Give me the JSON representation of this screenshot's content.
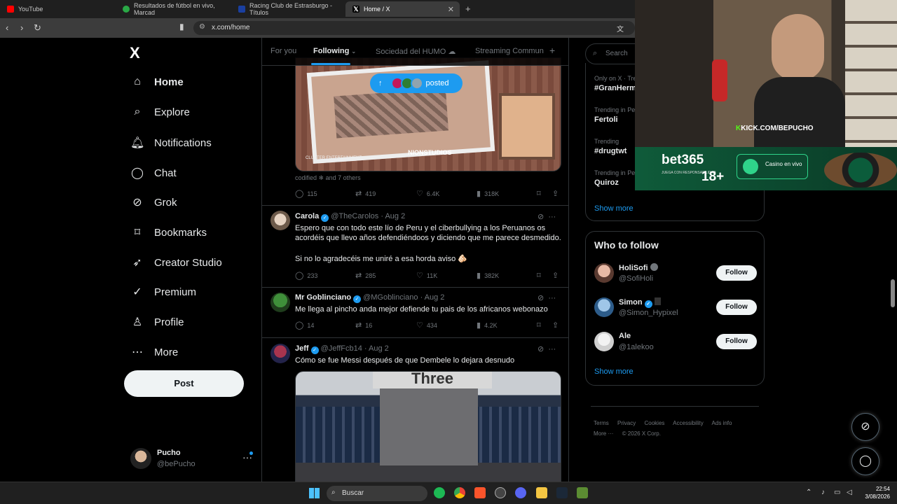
{
  "browser": {
    "tabs": [
      {
        "title": "YouTube",
        "color": "#ff0000"
      },
      {
        "title": "Resultados de fútbol en vivo, Marcad",
        "color": "#2aa846"
      },
      {
        "title": "Racing Club de Estrasburgo - Títulos",
        "color": "#1a3fa0"
      },
      {
        "title": "Home / X",
        "color": "#000000"
      }
    ],
    "url": "x.com/home"
  },
  "sidebar": {
    "logo": "X",
    "items": [
      {
        "label": "Home",
        "icon": "⌂"
      },
      {
        "label": "Explore",
        "icon": "⌕"
      },
      {
        "label": "Notifications",
        "icon": "♫"
      },
      {
        "label": "Chat",
        "icon": "◯"
      },
      {
        "label": "Grok",
        "icon": "⊘"
      },
      {
        "label": "Bookmarks",
        "icon": "⌑"
      },
      {
        "label": "Creator Studio",
        "icon": "➶"
      },
      {
        "label": "Premium",
        "icon": "✓"
      },
      {
        "label": "Profile",
        "icon": "♙"
      },
      {
        "label": "More",
        "icon": "⋯"
      }
    ],
    "post_label": "Post",
    "account": {
      "name": "Pucho",
      "handle": "@bePucho"
    }
  },
  "feed": {
    "tabs": [
      "For you",
      "Following",
      "Sociedad del HUMO ☁",
      "Streaming Commun"
    ],
    "posted_pill": "posted",
    "first_post": {
      "media_caption": "CLUSTER ENTERTAINMENT",
      "media_brand": "NIONSTUDIOS",
      "likers": "codified ❄ and 7 others",
      "replies": "115",
      "reposts": "419",
      "likes": "6.4K",
      "views": "318K"
    },
    "tweets": [
      {
        "name": "Carola",
        "handle": "@TheCarolos",
        "date": "· Aug 2",
        "text": "Espero que con todo este lío de Peru y el ciberbullying a los Peruanos os acordéis que llevo años defendiéndoos y diciendo que me parece desmedido.",
        "text2": "Si no lo agradecéis me uniré a esa horda aviso 🫵🏻",
        "replies": "233",
        "reposts": "285",
        "likes": "11K",
        "views": "382K"
      },
      {
        "name": "Mr Goblinciano",
        "handle": "@MGoblinciano",
        "date": "· Aug 2",
        "text": "Me llega al pincho anda mejor defiende tu pais de los africanos webonazo",
        "replies": "14",
        "reposts": "16",
        "likes": "434",
        "views": "4.2K"
      },
      {
        "name": "Jeff",
        "handle": "@JeffFcb14",
        "date": "· Aug 2",
        "text": "Cómo se fue Messi después de que Dembele lo dejara desnudo",
        "media_text": "Three"
      }
    ]
  },
  "right": {
    "search_placeholder": "Search",
    "trends": [
      {
        "context": "Only on X · Tre",
        "topic": "#GranHerm"
      },
      {
        "context": "Trending in Pe",
        "topic": "Fertoli"
      },
      {
        "context": "Trending",
        "topic": "#drugtwt"
      },
      {
        "context": "Trending in Pe",
        "topic": "Quiroz"
      }
    ],
    "show_more": "Show more",
    "who_to_follow_title": "Who to follow",
    "follow_suggestions": [
      {
        "name": "HoliSofi",
        "handle": "@SofiHoli"
      },
      {
        "name": "Simon",
        "handle": "@Simon_Hypixel"
      },
      {
        "name": "Ale",
        "handle": "@1alekoo"
      }
    ],
    "follow_label": "Follow",
    "footer_links": [
      "Terms",
      "Privacy",
      "Cookies",
      "Accessibility",
      "Ads info",
      "More ···",
      "© 2026 X Corp."
    ]
  },
  "overlay": {
    "kick_text": "KICK.COM/BEPUCHO",
    "bet_brand": "bet365",
    "bet_age": "18+",
    "bet_disclaimer": "JUEGA CON RESPONSABILIDAD",
    "casino_label": "Casino en vivo"
  },
  "taskbar": {
    "search_label": "Buscar",
    "time": "22:54",
    "date": "3/08/2026"
  },
  "colors": {
    "accent": "#1d9bf0",
    "background": "#000000",
    "border": "#2f3336"
  }
}
